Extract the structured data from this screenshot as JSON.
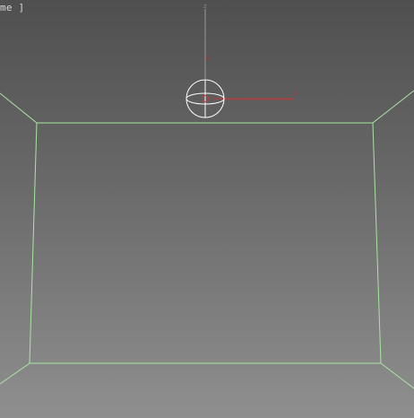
{
  "viewport": {
    "label": "me ]"
  },
  "gizmo": {
    "axis_z_label": "z",
    "axis_y_label": "y",
    "axis_x_label": "x"
  },
  "colors": {
    "edge_wire": "#a8e6a0",
    "axis_red": "#c43a3a",
    "axis_gray": "#9a9a9a",
    "gizmo_white": "#ffffff"
  }
}
